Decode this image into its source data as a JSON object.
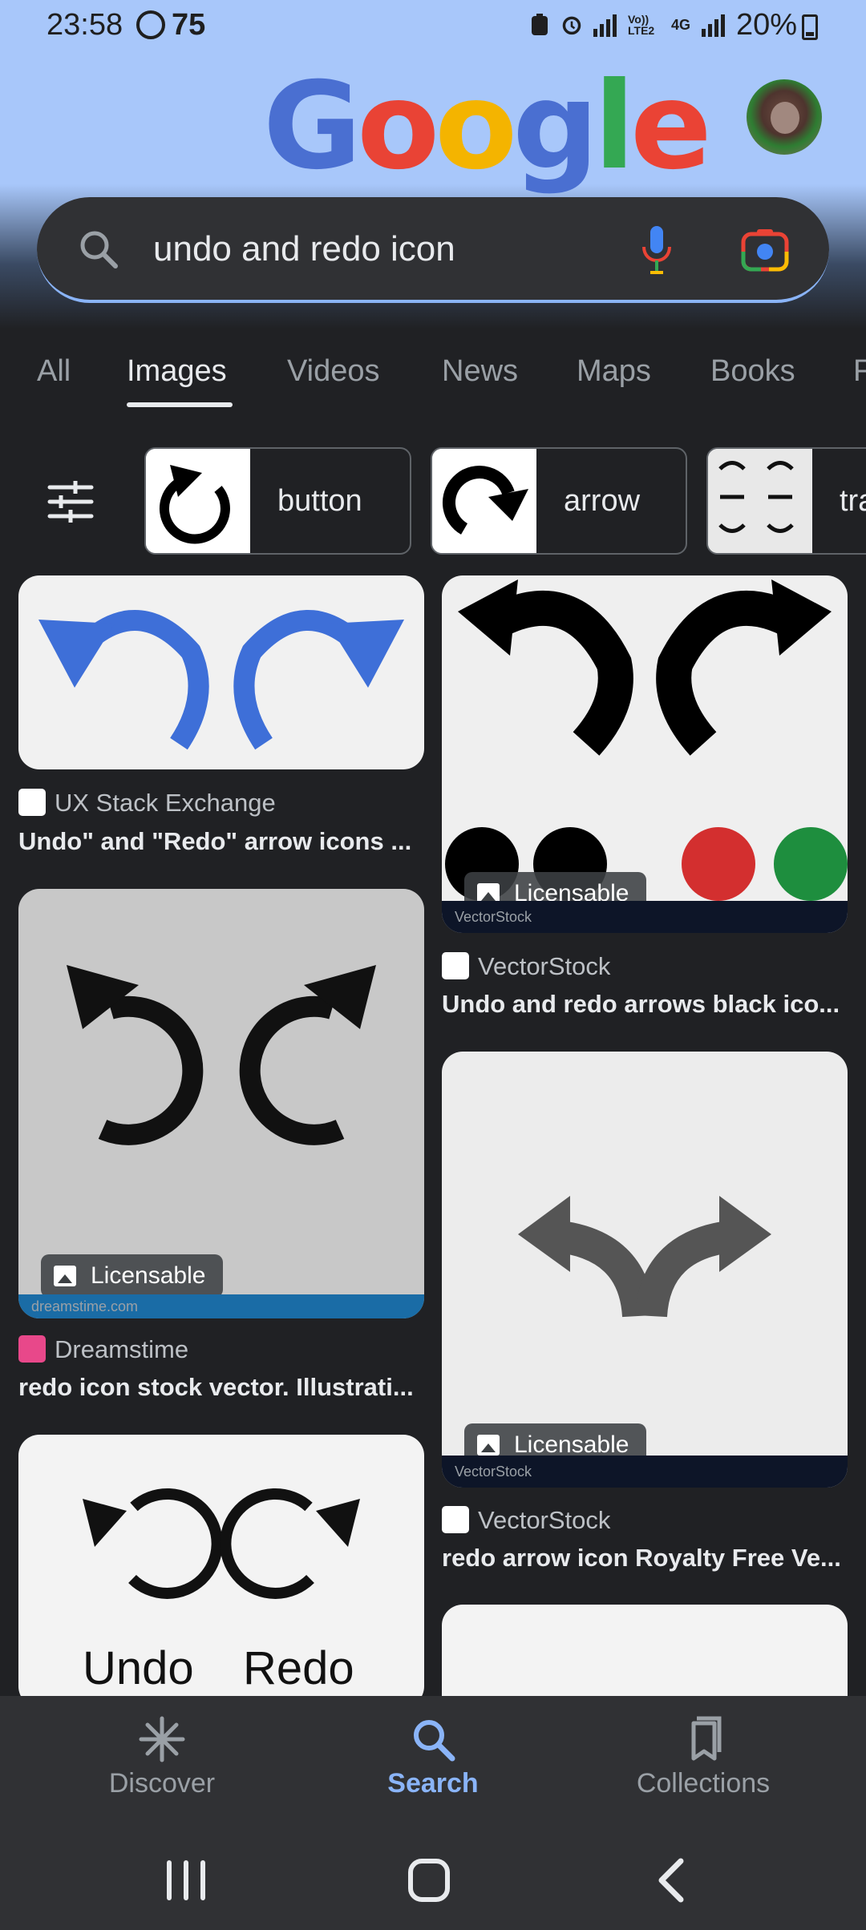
{
  "status_bar": {
    "time": "23:58",
    "notification_count": "75",
    "volte": "Vo)) LTE2",
    "network": "4G",
    "battery": "20%"
  },
  "header": {
    "logo_letters": [
      "G",
      "o",
      "o",
      "g",
      "l",
      "e"
    ],
    "logo_colors": [
      "#4a6fd1",
      "#e94335",
      "#f4b400",
      "#4a6fd1",
      "#34a853",
      "#ea4335"
    ]
  },
  "search": {
    "query": "undo and redo icon"
  },
  "tabs": [
    {
      "label": "All"
    },
    {
      "label": "Images"
    },
    {
      "label": "Videos"
    },
    {
      "label": "News"
    },
    {
      "label": "Maps"
    },
    {
      "label": "Books"
    }
  ],
  "active_tab": "Images",
  "chips": [
    {
      "label": "button"
    },
    {
      "label": "arrow"
    },
    {
      "label": "tra"
    }
  ],
  "results": [
    {
      "source": "UX Stack Exchange",
      "title": "Undo\" and \"Redo\" arrow icons ...",
      "licensable": "",
      "favicon_color": "#ffffff"
    },
    {
      "source": "VectorStock",
      "title": "Undo and redo arrows black ico...",
      "licensable": "Licensable",
      "favicon_color": "#ffffff",
      "watermark": "VectorStock"
    },
    {
      "source": "Dreamstime",
      "title": "redo icon stock vector. Illustrati...",
      "licensable": "Licensable",
      "favicon_color": "#e8488a",
      "watermark": "dreamstime.com"
    },
    {
      "source": "VectorStock",
      "title": "redo arrow icon Royalty Free Ve...",
      "licensable": "Licensable",
      "favicon_color": "#ffffff",
      "watermark": "VectorStock"
    },
    {
      "image_text_left": "Undo",
      "image_text_right": "Redo"
    }
  ],
  "bottom_nav": [
    {
      "label": "Discover",
      "icon": "asterisk-icon"
    },
    {
      "label": "Search",
      "icon": "search-icon"
    },
    {
      "label": "Collections",
      "icon": "collections-icon"
    }
  ],
  "colors": {
    "accent": "#8ab4f8",
    "background": "#202124",
    "header_bg": "#a8c7fa"
  }
}
